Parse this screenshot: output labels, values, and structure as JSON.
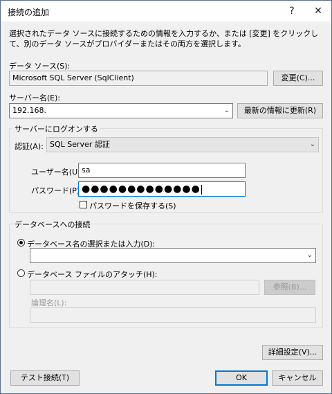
{
  "window": {
    "title": "接続の追加",
    "help_glyph": "?",
    "close_glyph": "✕"
  },
  "description": "選択されたデータ ソースに接続するための情報を入力するか、または [変更] をクリックして、別のデータ ソースがプロバイダーまたはその両方を選択します。",
  "data_source": {
    "label": "データ ソース(S):",
    "value": "Microsoft SQL Server (SqlClient)",
    "change_button": "変更(C)..."
  },
  "server": {
    "label": "サーバー名(E):",
    "value": "192.168.",
    "refresh_button": "最新の情報に更新(R)"
  },
  "logon": {
    "group_label": "サーバーにログオンする",
    "auth_label": "認証(A):",
    "auth_value": "SQL Server 認証",
    "username_label": "ユーザー名(U):",
    "username_value": "sa",
    "password_label": "パスワード(P):",
    "password_value": "●●●●●●●●●●●●●",
    "save_password_label": "パスワードを保存する(S)",
    "save_password_checked": false
  },
  "database": {
    "group_label": "データベースへの接続",
    "select_option_label": "データベース名の選択または入力(D):",
    "select_option_checked": true,
    "select_value": "",
    "attach_option_label": "データベース ファイルのアタッチ(H):",
    "attach_option_checked": false,
    "attach_value": "",
    "browse_button": "参照(B)...",
    "logical_name_label": "論理名(L):",
    "logical_name_value": ""
  },
  "buttons": {
    "advanced": "詳細設定(V)...",
    "test": "テスト接続(T)",
    "ok": "OK",
    "cancel": "キャンセル"
  },
  "icons": {
    "dropdown": "chevron-down-icon"
  }
}
